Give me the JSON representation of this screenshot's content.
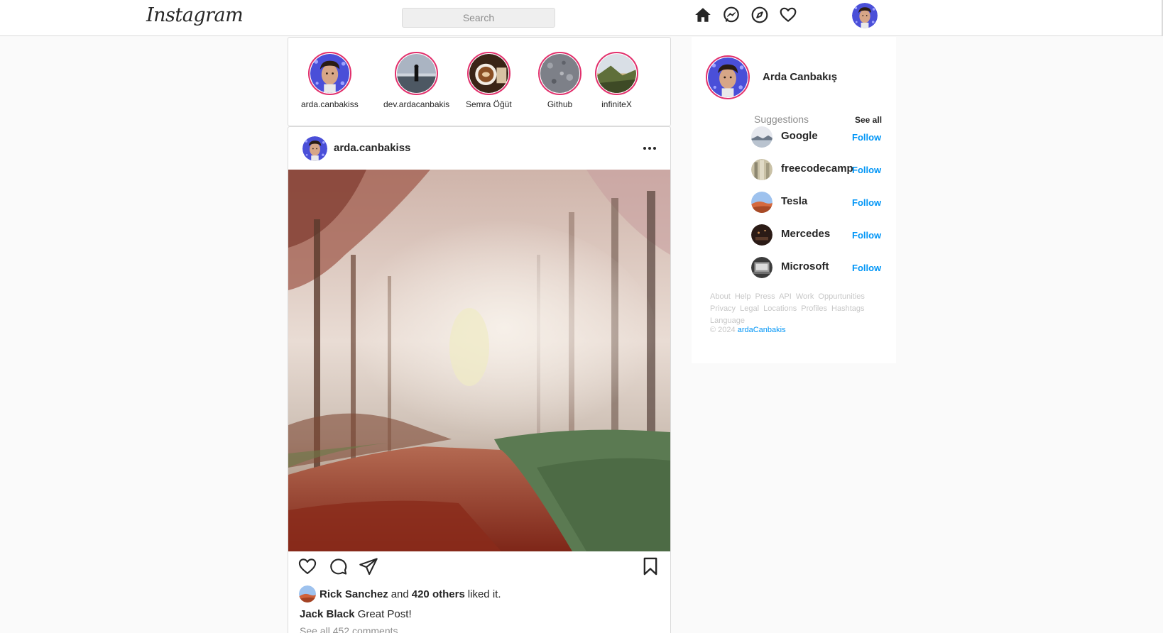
{
  "header": {
    "logo_text": "Instagram",
    "search_placeholder": "Search",
    "icons": [
      "home-icon",
      "messenger-icon",
      "explore-icon",
      "heart-icon"
    ]
  },
  "stories": [
    {
      "name": "arda.canbakiss"
    },
    {
      "name": "dev.ardacanbakis"
    },
    {
      "name": "Semra Öğüt"
    },
    {
      "name": "Github"
    },
    {
      "name": "infiniteX"
    }
  ],
  "post": {
    "username": "arda.canbakiss",
    "likes": {
      "liker": "Rick Sanchez",
      "and_text": "and",
      "others": "420 others",
      "suffix": "liked it."
    },
    "caption": {
      "user": "Jack Black",
      "text": "Great Post!"
    },
    "see_comments": "See all 452 comments"
  },
  "sidebar": {
    "profile_name": "Arda Canbakış",
    "suggestions_title": "Suggestions",
    "see_all": "See all",
    "suggestions": [
      {
        "name": "Google",
        "action": "Follow"
      },
      {
        "name": "freecodecamp",
        "action": "Follow"
      },
      {
        "name": "Tesla",
        "action": "Follow"
      },
      {
        "name": "Mercedes",
        "action": "Follow"
      },
      {
        "name": "Microsoft",
        "action": "Follow"
      }
    ],
    "footer_links": [
      "About",
      "Help",
      "Press",
      "API",
      "Work",
      "Oppurtunities",
      "Privacy",
      "Legal",
      "Locations",
      "Profiles",
      "Hashtags",
      "Language"
    ],
    "copyright_prefix": "© 2024",
    "copyright_link": "ardaCanbakis"
  },
  "colors": {
    "story_ring": "#e1306c",
    "follow_blue": "#0095f6",
    "border": "#dbdbdb",
    "background": "#fafafa"
  }
}
